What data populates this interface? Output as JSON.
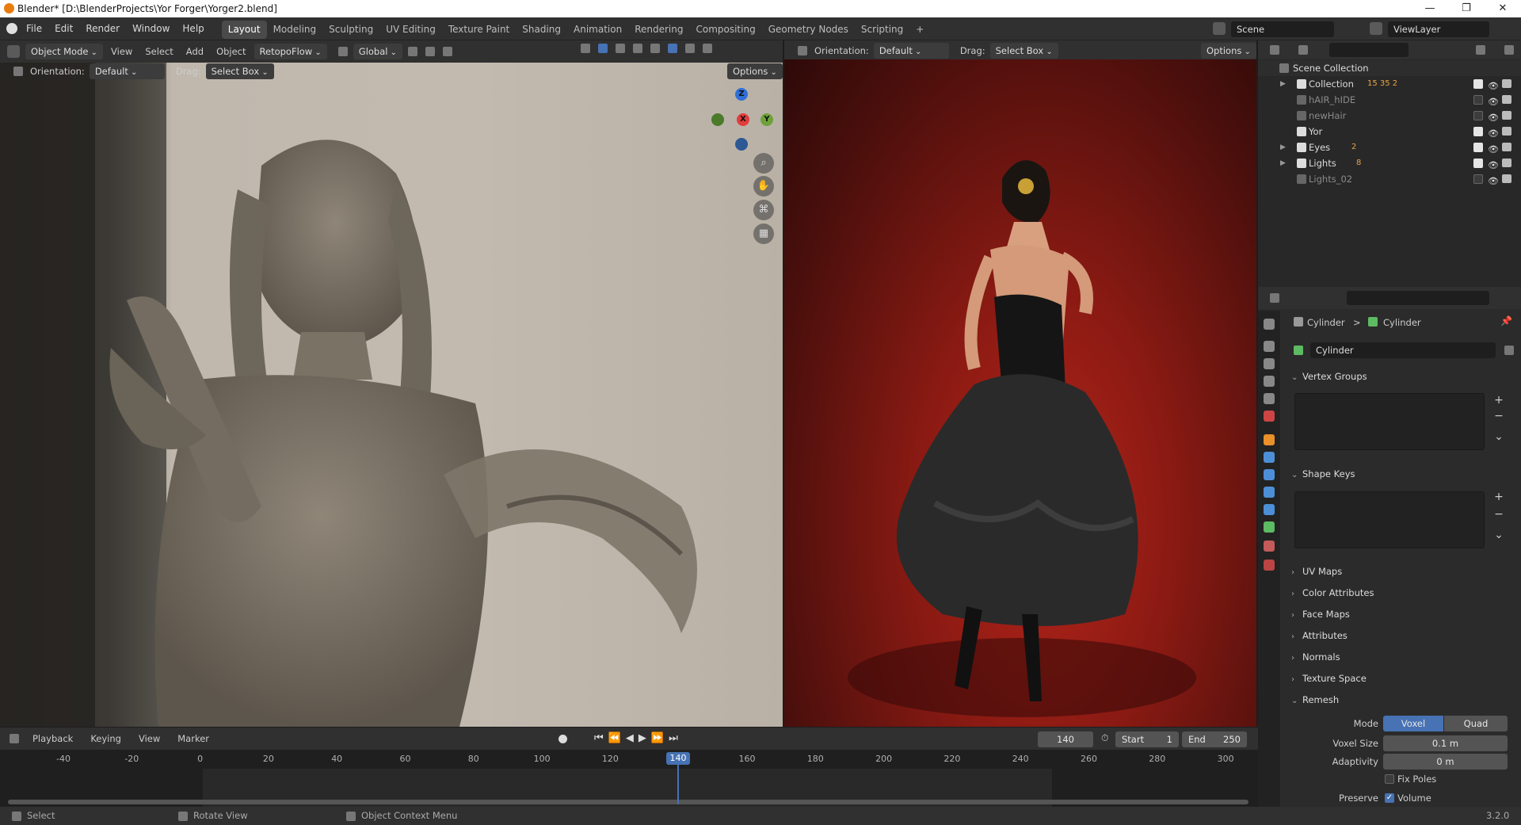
{
  "window": {
    "title": "Blender* [D:\\BlenderProjects\\Yor Forger\\Yorger2.blend]",
    "minimize": "—",
    "maximize": "❐",
    "close": "✕"
  },
  "menu": [
    "File",
    "Edit",
    "Render",
    "Window",
    "Help"
  ],
  "workspaces": [
    "Layout",
    "Modeling",
    "Sculpting",
    "UV Editing",
    "Texture Paint",
    "Shading",
    "Animation",
    "Rendering",
    "Compositing",
    "Geometry Nodes",
    "Scripting"
  ],
  "workspace_add": "+",
  "scene": {
    "name": "Scene",
    "view_layer": "ViewLayer"
  },
  "viewport_left": {
    "mode": "Object Mode",
    "menus": [
      "View",
      "Select",
      "Add",
      "Object"
    ],
    "addon": "RetopoFlow",
    "transform": "Global",
    "orientation_label": "Orientation:",
    "orientation": "Default",
    "drag_label": "Drag:",
    "drag": "Select Box",
    "options": "Options",
    "gizmo": {
      "z": "Z",
      "x": "X",
      "y": "Y"
    }
  },
  "viewport_right": {
    "orientation_label": "Orientation:",
    "orientation": "Default",
    "drag_label": "Drag:",
    "drag": "Select Box",
    "options": "Options"
  },
  "outliner": {
    "root": "Scene Collection",
    "items": [
      {
        "name": "Collection",
        "expandable": true,
        "checked": true,
        "sub": "15 35 2"
      },
      {
        "name": "hAIR_hIDE",
        "expandable": false,
        "checked": false
      },
      {
        "name": "newHair",
        "expandable": false,
        "checked": false
      },
      {
        "name": "Yor",
        "expandable": false,
        "checked": true
      },
      {
        "name": "Eyes",
        "expandable": true,
        "checked": true,
        "sub": "2"
      },
      {
        "name": "Lights",
        "expandable": true,
        "checked": true,
        "sub": "8"
      },
      {
        "name": "Lights_02",
        "expandable": false,
        "checked": false
      }
    ]
  },
  "properties": {
    "breadcrumb_object": "Cylinder",
    "breadcrumb_sep": ">",
    "breadcrumb_data": "Cylinder",
    "datablock": "Cylinder",
    "sections": {
      "vertex_groups": "Vertex Groups",
      "shape_keys": "Shape Keys",
      "uv_maps": "UV Maps",
      "color_attributes": "Color Attributes",
      "face_maps": "Face Maps",
      "attributes": "Attributes",
      "normals": "Normals",
      "texture_space": "Texture Space",
      "remesh": "Remesh"
    },
    "remesh": {
      "mode_label": "Mode",
      "mode_voxel": "Voxel",
      "mode_quad": "Quad",
      "voxel_size_label": "Voxel Size",
      "voxel_size": "0.1 m",
      "adaptivity_label": "Adaptivity",
      "adaptivity": "0 m",
      "fix_poles": "Fix Poles",
      "preserve_label": "Preserve",
      "volume": "Volume"
    }
  },
  "timeline": {
    "menus": [
      "Playback",
      "Keying",
      "View",
      "Marker"
    ],
    "current_frame": "140",
    "start_label": "Start",
    "start": "1",
    "end_label": "End",
    "end": "250",
    "ticks": [
      "-40",
      "-20",
      "0",
      "20",
      "40",
      "60",
      "80",
      "100",
      "120",
      "140",
      "160",
      "180",
      "200",
      "220",
      "240",
      "260",
      "280",
      "300"
    ],
    "playhead": "140"
  },
  "statusbar": {
    "select": "Select",
    "rotate": "Rotate View",
    "context": "Object Context Menu",
    "version": "3.2.0"
  },
  "colors": {
    "accent": "#4772b3",
    "orange": "#e87d0d",
    "header": "#303030"
  }
}
